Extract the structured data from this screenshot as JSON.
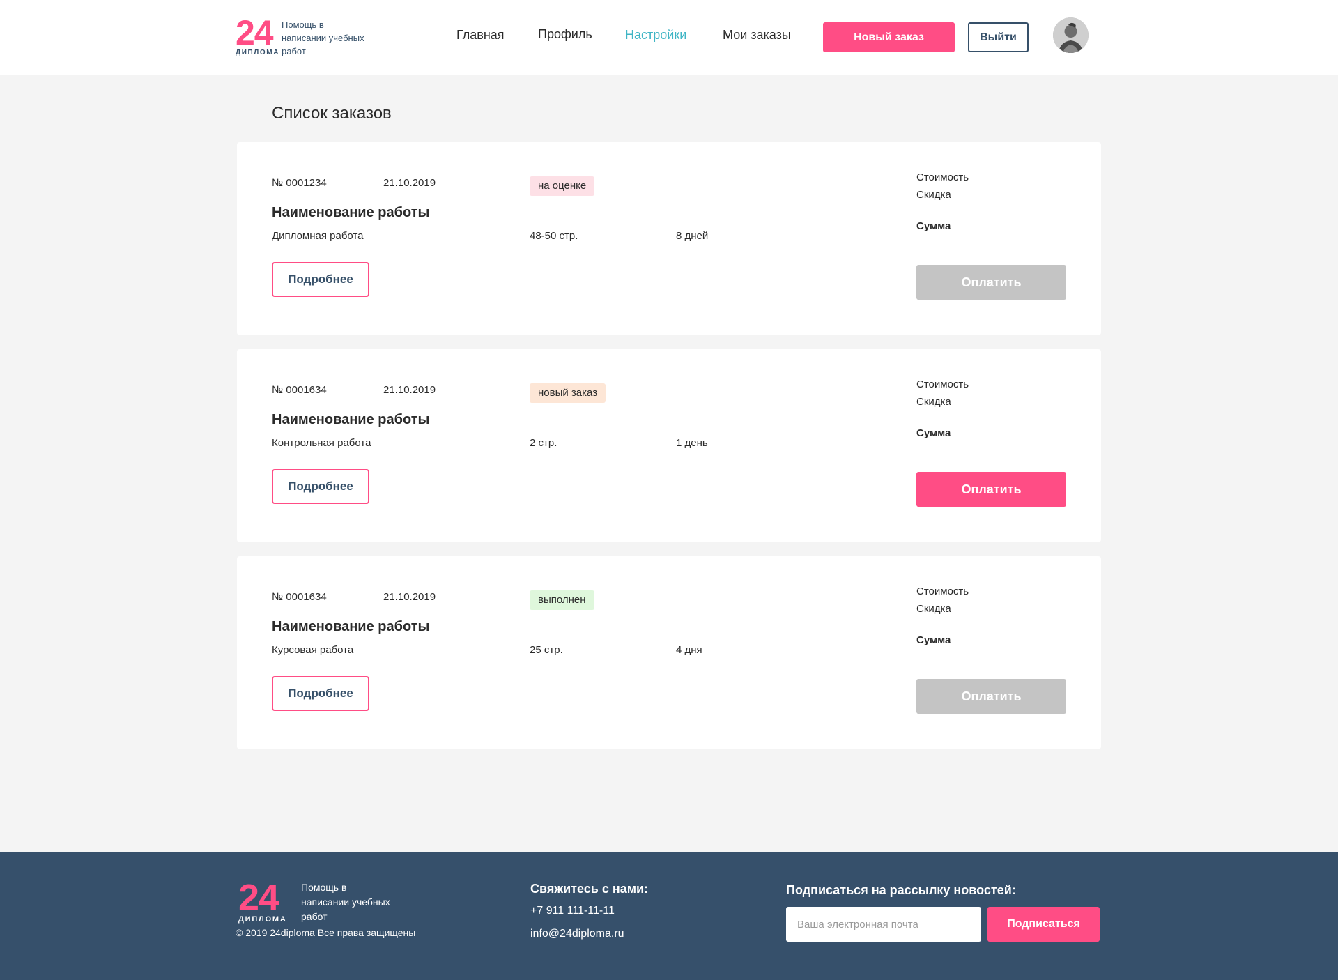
{
  "brand": {
    "logo_number": "24",
    "logo_caption": "ДИПЛОМА",
    "tagline": "Помощь в написании учебных работ",
    "accent_color": "#ff4d85",
    "dark_color": "#36506b",
    "active_color": "#3fb5c5"
  },
  "nav": {
    "items": [
      {
        "label": "Главная",
        "active": false
      },
      {
        "label": "Профиль",
        "active": false
      },
      {
        "label": "Настройки",
        "active": true
      },
      {
        "label": "Мои заказы",
        "active": false
      }
    ],
    "new_order_label": "Новый заказ",
    "logout_label": "Выйти",
    "avatar_icon": "user-avatar-photo"
  },
  "main": {
    "title": "Список заказов",
    "details_label": "Подробнее",
    "cost_label": "Стоимость",
    "discount_label": "Скидка",
    "sum_label": "Сумма",
    "pay_label": "Оплатить",
    "orders": [
      {
        "number": "№ 0001234",
        "date": "21.10.2019",
        "status": "на оценке",
        "status_color": "#fde0e6",
        "title": "Наименование работы",
        "type": "Дипломная работа",
        "pages": "48-50 стр.",
        "duration": "8 дней",
        "pay_enabled": false
      },
      {
        "number": "№ 0001634",
        "date": "21.10.2019",
        "status": "новый заказ",
        "status_color": "#fde6d6",
        "title": "Наименование работы",
        "type": "Контрольная работа",
        "pages": "2 стр.",
        "duration": "1 день",
        "pay_enabled": true
      },
      {
        "number": "№ 0001634",
        "date": "21.10.2019",
        "status": "выполнен",
        "status_color": "#dff7dc",
        "title": "Наименование работы",
        "type": "Курсовая работа",
        "pages": "25 стр.",
        "duration": "4 дня",
        "pay_enabled": false
      }
    ]
  },
  "footer": {
    "logo_number": "24",
    "logo_caption": "ДИПЛОМА",
    "tagline": "Помощь в написании учебных работ",
    "copyright": "© 2019 24diploma Все права защищены",
    "contact_title": "Свяжитесь с нами:",
    "phone": "+7 911 111-11-11",
    "email": "info@24diploma.ru",
    "subscribe_title": "Подписаться на рассылку новостей:",
    "subscribe_placeholder": "Ваша электронная почта",
    "subscribe_button": "Подписаться"
  }
}
